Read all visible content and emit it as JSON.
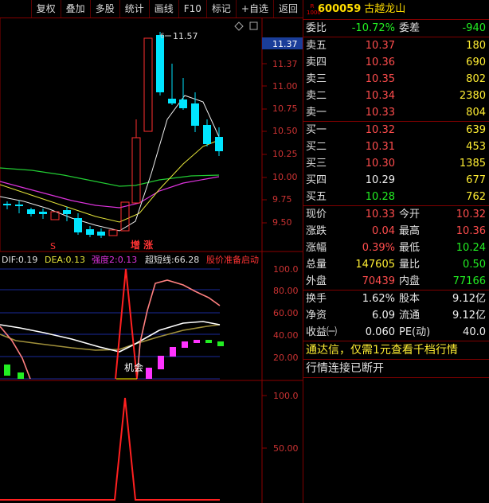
{
  "toolbar": {
    "buttons": [
      "复权",
      "叠加",
      "多股",
      "统计",
      "画线",
      "F10",
      "标记",
      "+自选",
      "返回"
    ]
  },
  "price_chart": {
    "high_label": "11.57",
    "current_price_tag": "11.37",
    "axis_labels": [
      "11.37",
      "11.00",
      "10.75",
      "10.50",
      "10.25",
      "10.00",
      "9.75",
      "9.50"
    ],
    "marker_s": "S",
    "marker_zengzhang": "增 涨"
  },
  "macd": {
    "dif_label": "DIF:",
    "dif_value": "0.19",
    "dea_label": "DEA:",
    "dea_value": "0.13",
    "strength_label": "强度2:",
    "strength_value": "0.13",
    "short_label": "超短线:",
    "short_value": "66.28",
    "ready_label": "股价准备启动",
    "axis_labels": [
      "100.0",
      "80.00",
      "60.00",
      "40.00",
      "20.00"
    ],
    "chance_label": "机会"
  },
  "bottom_chart": {
    "axis_labels": [
      "100.0",
      "50.00"
    ]
  },
  "quote": {
    "badge_top": "R",
    "badge_bottom": "1000",
    "code": "600059",
    "name": "古越龙山",
    "weibi_label": "委比",
    "weibi_value": "-10.72%",
    "weicha_label": "委差",
    "weicha_value": "-940",
    "sell": [
      {
        "label": "卖五",
        "price": "10.37",
        "vol": "180"
      },
      {
        "label": "卖四",
        "price": "10.36",
        "vol": "690"
      },
      {
        "label": "卖三",
        "price": "10.35",
        "vol": "802"
      },
      {
        "label": "卖二",
        "price": "10.34",
        "vol": "2380"
      },
      {
        "label": "卖一",
        "price": "10.33",
        "vol": "804"
      }
    ],
    "buy": [
      {
        "label": "买一",
        "price": "10.32",
        "vol": "639"
      },
      {
        "label": "买二",
        "price": "10.31",
        "vol": "453"
      },
      {
        "label": "买三",
        "price": "10.30",
        "vol": "1385"
      },
      {
        "label": "买四",
        "price": "10.29",
        "vol": "677"
      },
      {
        "label": "买五",
        "price": "10.28",
        "vol": "762"
      }
    ],
    "stats": [
      {
        "l1": "现价",
        "v1": "10.33",
        "c1": "red",
        "l2": "今开",
        "v2": "10.32",
        "c2": "red"
      },
      {
        "l1": "涨跌",
        "v1": "0.04",
        "c1": "red",
        "l2": "最高",
        "v2": "10.36",
        "c2": "red"
      },
      {
        "l1": "涨幅",
        "v1": "0.39%",
        "c1": "red",
        "l2": "最低",
        "v2": "10.24",
        "c2": "green"
      },
      {
        "l1": "总量",
        "v1": "147605",
        "c1": "yellow",
        "l2": "量比",
        "v2": "0.50",
        "c2": "green"
      },
      {
        "l1": "外盘",
        "v1": "70439",
        "c1": "red",
        "l2": "内盘",
        "v2": "77166",
        "c2": "green"
      }
    ],
    "finance": [
      {
        "l1": "换手",
        "v1": "1.62%",
        "l2": "股本",
        "v2": "9.12亿"
      },
      {
        "l1": "净资",
        "v1": "6.09",
        "l2": "流通",
        "v2": "9.12亿"
      },
      {
        "l1": "收益㈠",
        "v1": "0.060",
        "l2": "PE(动)",
        "v2": "40.0"
      }
    ],
    "notice": "通达信，仅需1元查看千档行情",
    "status": "行情连接已断开"
  },
  "colors": {
    "up": "#ff3030",
    "down": "#00e5ff",
    "frame": "#8b0000",
    "grid": "#1a2a9a"
  }
}
